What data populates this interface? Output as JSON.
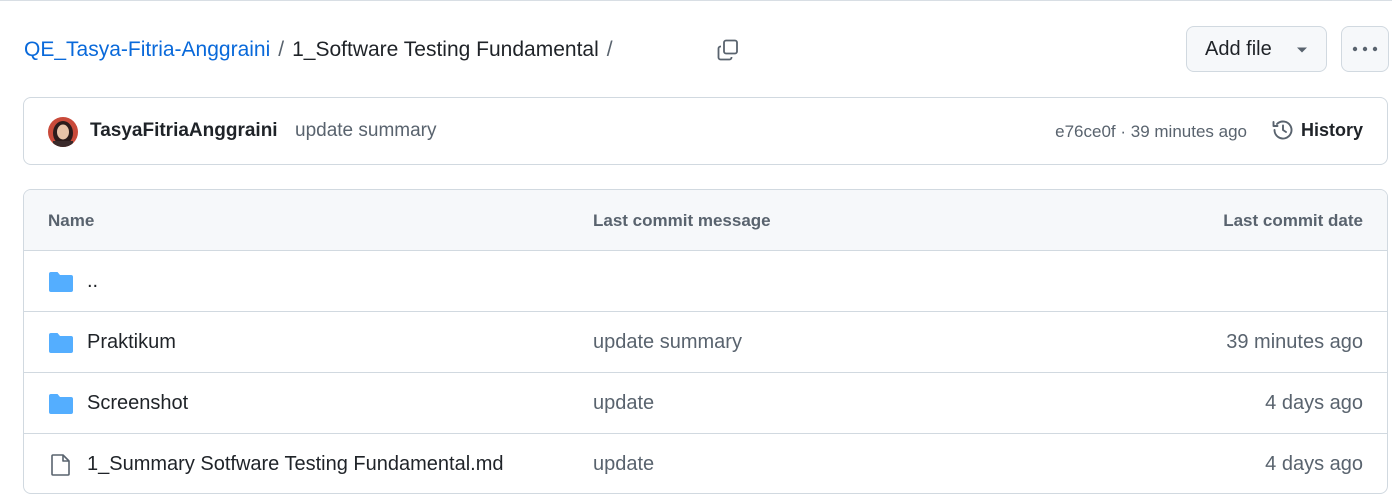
{
  "breadcrumb": {
    "repo": "QE_Tasya-Fitria-Anggraini",
    "separator": "/",
    "directory": "1_Software Testing Fundamental",
    "trailing_separator": "/"
  },
  "icons": {
    "copy": "copy-icon",
    "caret": "triangle-down-icon",
    "more": "kebab-horizontal-icon",
    "history": "history-icon",
    "folder": "folder-icon",
    "file": "file-icon"
  },
  "toolbar": {
    "add_file_label": "Add file"
  },
  "commit": {
    "author": "TasyaFitriaAnggraini",
    "message": "update summary",
    "meta": "e76ce0f · 39 minutes ago",
    "history_label": "History"
  },
  "table": {
    "headers": {
      "name": "Name",
      "message": "Last commit message",
      "date": "Last commit date"
    },
    "rows": [
      {
        "type": "folder",
        "name": "..",
        "message": "",
        "date": ""
      },
      {
        "type": "folder",
        "name": "Praktikum",
        "message": "update summary",
        "date": "39 minutes ago"
      },
      {
        "type": "folder",
        "name": "Screenshot",
        "message": "update",
        "date": "4 days ago"
      },
      {
        "type": "file",
        "name": "1_Summary Sotfware Testing Fundamental.md",
        "message": "update",
        "date": "4 days ago"
      }
    ]
  },
  "colors": {
    "link": "#0969da",
    "folder": "#54aeff",
    "muted": "#59636e",
    "border": "#d1d9e0"
  }
}
